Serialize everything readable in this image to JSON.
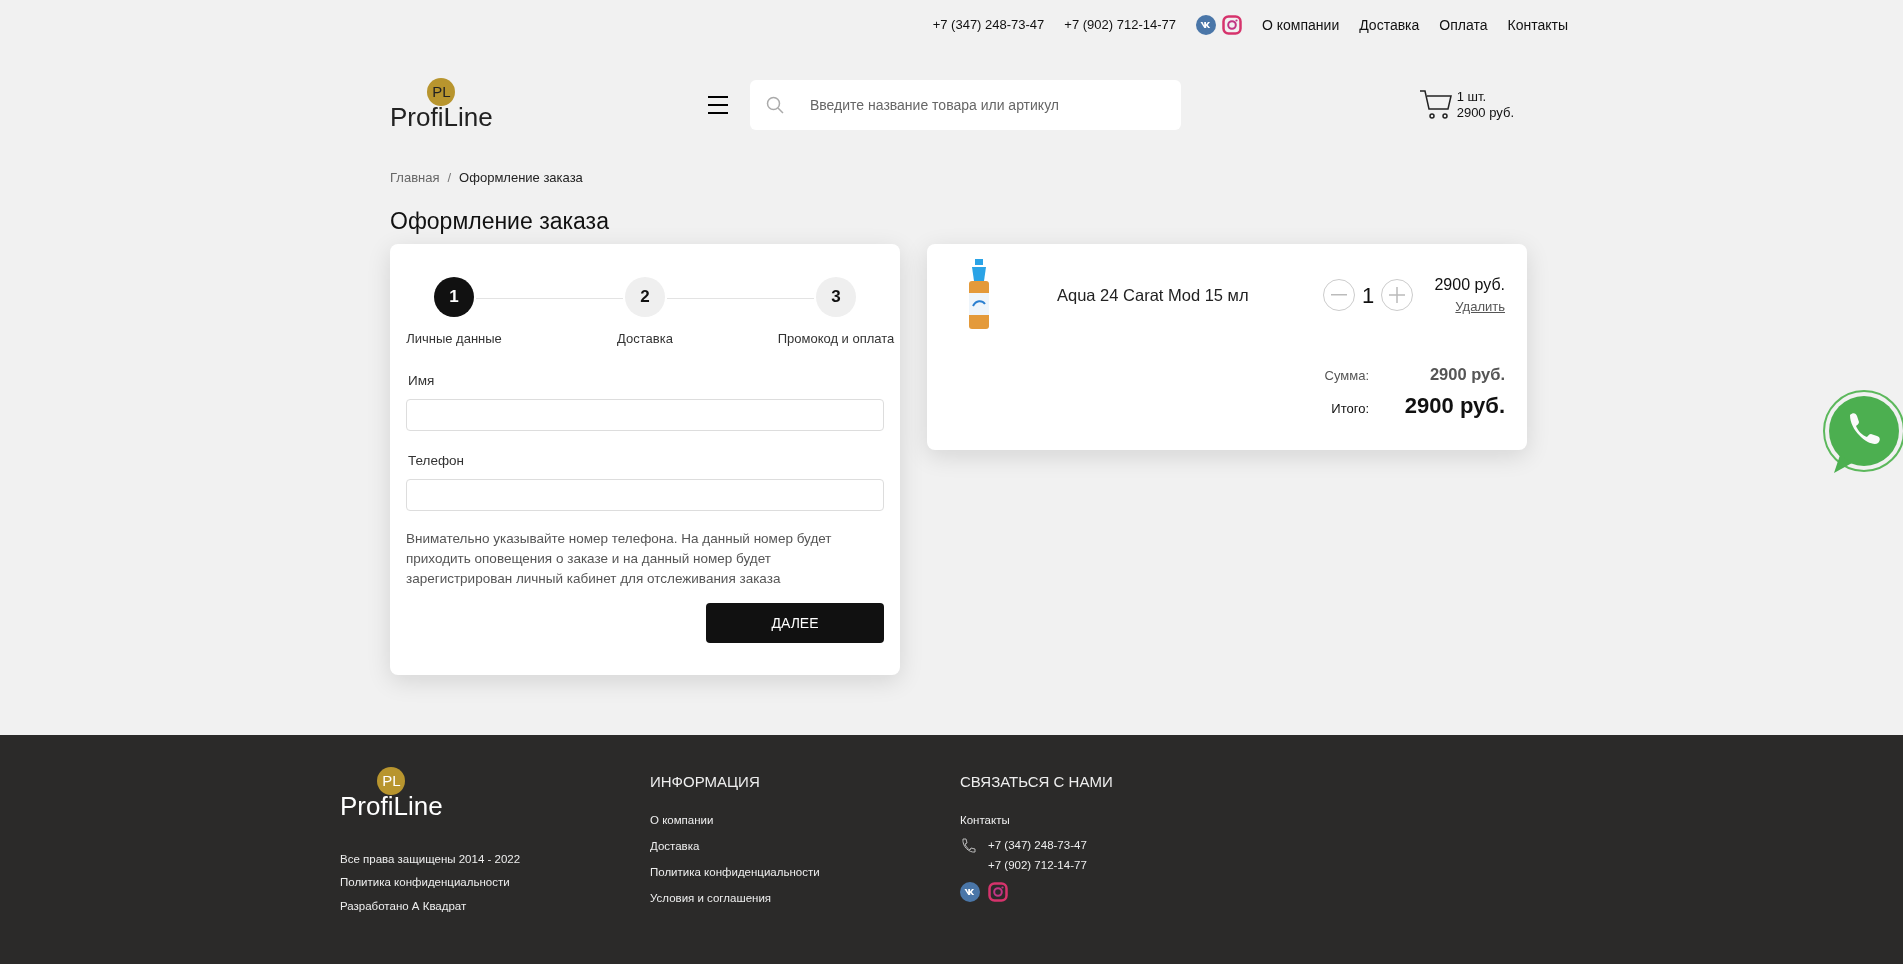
{
  "top_bar": {
    "phones": [
      "+7 (347) 248-73-47",
      "+7 (902) 712-14-77"
    ],
    "nav": [
      "О компании",
      "Доставка",
      "Оплата",
      "Контакты"
    ]
  },
  "header": {
    "logo": {
      "mark": "PL",
      "name": "ProfiLine"
    },
    "search": {
      "placeholder": "Введите название товара или артикул"
    },
    "cart": {
      "count": "1 шт.",
      "total": "2900 руб."
    }
  },
  "breadcrumbs": {
    "separator": "/",
    "items": [
      {
        "label": "Главная",
        "link": true
      },
      {
        "label": "Оформление заказа",
        "link": false
      }
    ]
  },
  "page_title": "Оформление заказа",
  "checkout": {
    "steps": [
      {
        "number": "1",
        "label": "Личные данные",
        "selected": true
      },
      {
        "number": "2",
        "label": "Доставка",
        "selected": false
      },
      {
        "number": "3",
        "label": "Промокод и оплата",
        "selected": false
      }
    ],
    "fields": [
      {
        "label": "Имя"
      },
      {
        "label": "Телефон"
      }
    ],
    "note": "Внимательно указывайте номер телефона. На данный номер будет приходить оповещения о заказе и на данный номер будет зарегистрирован личный кабинет для отслеживания заказа",
    "next_button": "ДАЛЕЕ"
  },
  "cart_summary": {
    "items": [
      {
        "name": "Aqua 24 Carat Mod 15 мл",
        "quantity": "1",
        "price": "2900 руб.",
        "remove": "Удалить"
      }
    ],
    "sum_label": "Сумма:",
    "sum": "2900 руб.",
    "total_label": "Итого:",
    "total": "2900 руб."
  },
  "footer": {
    "logo": {
      "mark": "PL",
      "name": "ProfiLine"
    },
    "legal": [
      "Все права защищены 2014 - 2022",
      "Политика конфиденциальности",
      "Разработано А Квадрат"
    ],
    "info": {
      "heading": "ИНФОРМАЦИЯ",
      "links": [
        "О компании",
        "Доставка",
        "Политика конфиденциальности",
        "Условия и соглашения"
      ]
    },
    "contact": {
      "heading": "СВЯЗАТЬСЯ С НАМИ",
      "link": "Контакты",
      "phones": [
        "+7 (347) 248-73-47",
        "+7 (902) 712-14-77"
      ]
    }
  }
}
